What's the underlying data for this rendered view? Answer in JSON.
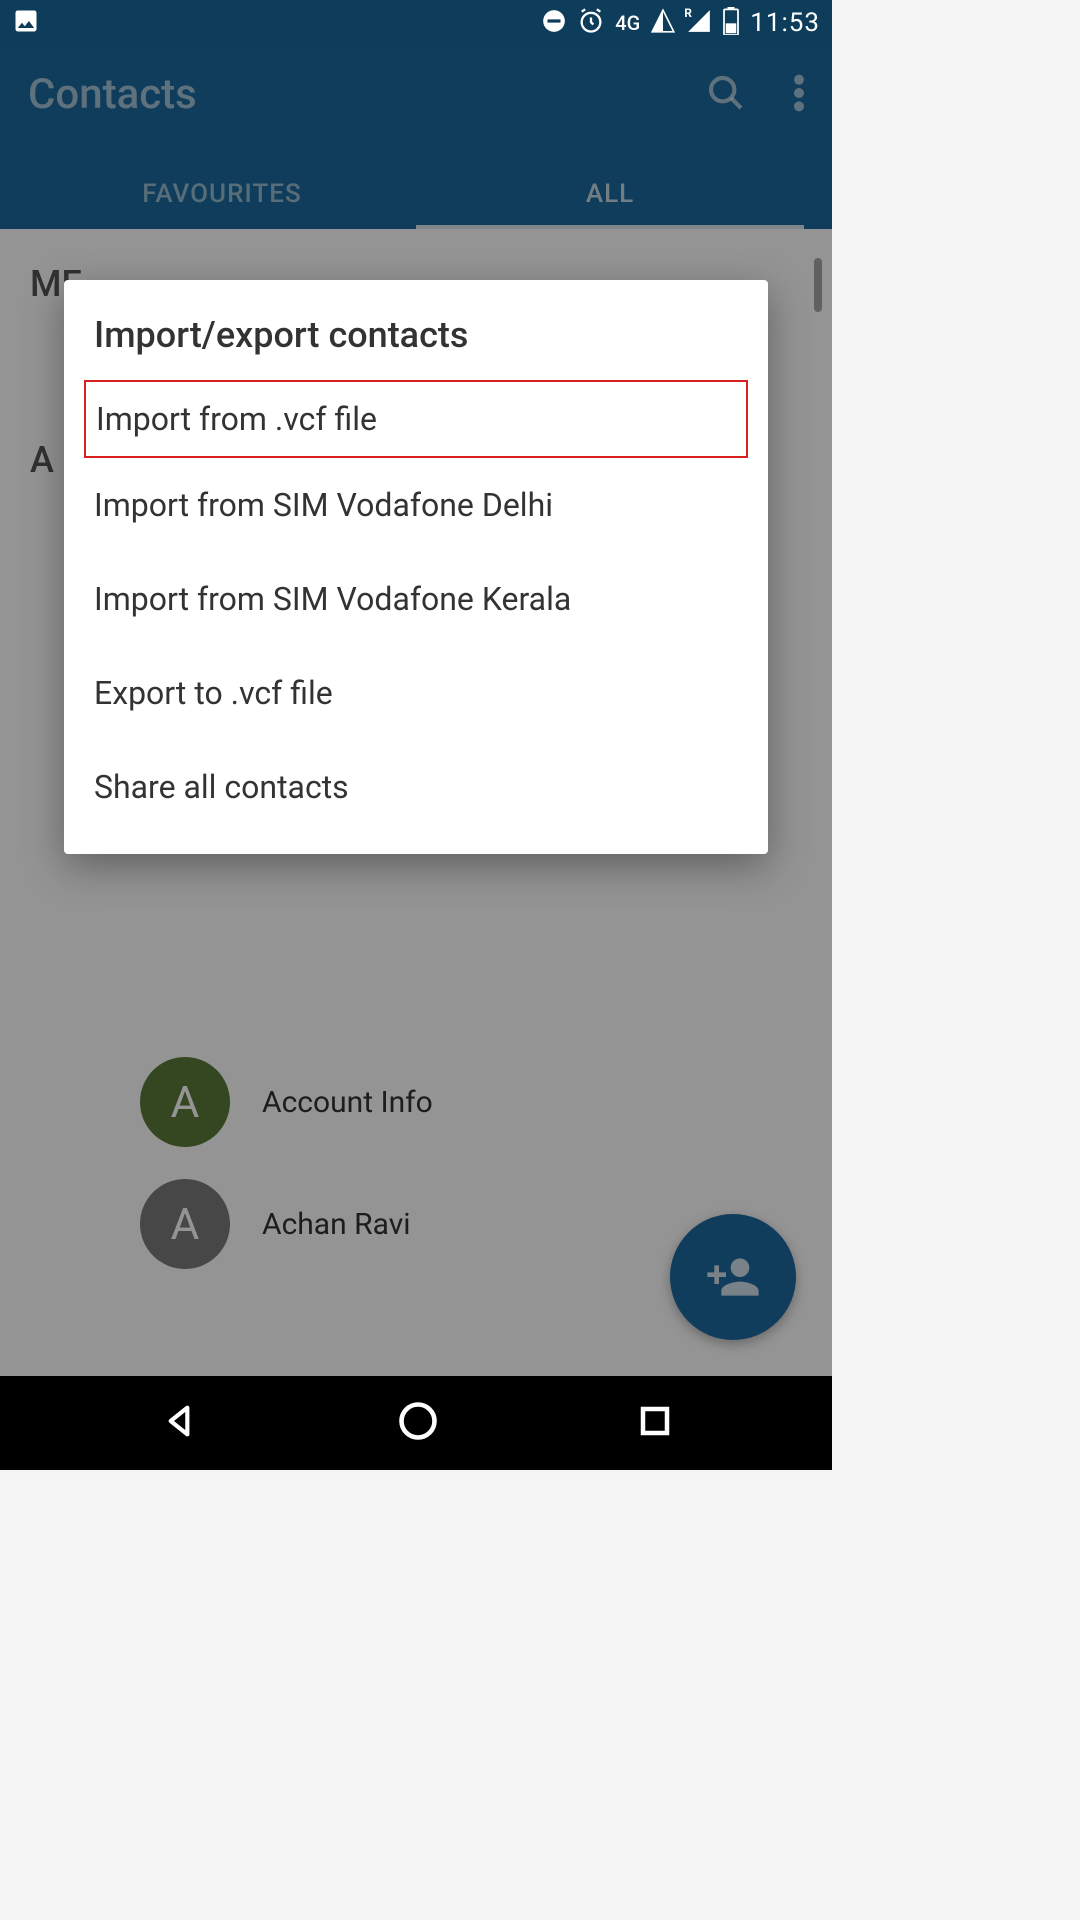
{
  "status": {
    "time": "11:53",
    "network": "4G",
    "roaming": "R"
  },
  "header": {
    "title": "Contacts"
  },
  "tabs": {
    "favourites": "FAVOURITES",
    "all": "ALL"
  },
  "sections": {
    "me": "ME",
    "a": "A"
  },
  "contacts": [
    {
      "letter": "A",
      "name": "Account Info",
      "color": "green"
    },
    {
      "letter": "A",
      "name": "Achan Ravi",
      "color": "grey"
    }
  ],
  "dialog": {
    "title": "Import/export contacts",
    "items": [
      "Import from .vcf file",
      "Import from SIM Vodafone Delhi",
      "Import from SIM Vodafone Kerala",
      "Export to .vcf file",
      "Share all contacts"
    ]
  }
}
